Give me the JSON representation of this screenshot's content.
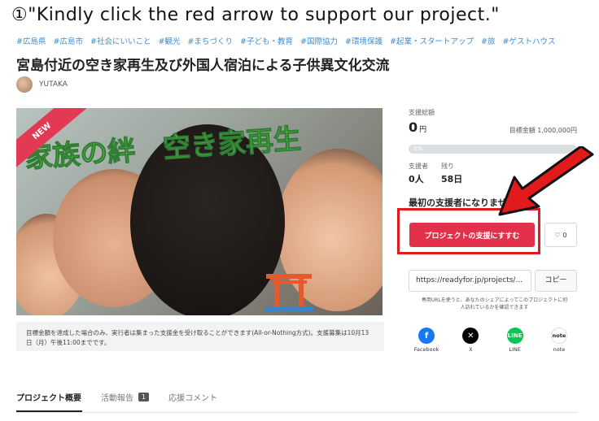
{
  "instruction": "①\"Kindly click the red arrow to support our project.\"",
  "tags": [
    "#広島県",
    "#広島市",
    "#社会にいいこと",
    "#観光",
    "#まちづくり",
    "#子ども・教育",
    "#国際協力",
    "#環境保護",
    "#起業・スタートアップ",
    "#旅",
    "#ゲストハウス"
  ],
  "project": {
    "title": "宮島付近の空き家再生及び外国人宿泊による子供異文化交流",
    "author": "YUTAKA",
    "hero_text": "家族の絆　空き家再生",
    "new_badge": "NEW"
  },
  "notice": "目標金額を達成した場合のみ、実行者は集まった支援金を受け取ることができます(All-or-Nothing方式)。支援募集は10月13日（月）午後11:00までです。",
  "funding": {
    "total_label": "支援総額",
    "amount": "0",
    "currency": "円",
    "goal": "目標金額 1,000,000円",
    "progress_text": "0%",
    "progress_fraction": 0,
    "supporters_label": "支援者",
    "supporters_value": "0人",
    "remaining_label": "残り",
    "remaining_value": "58日"
  },
  "cta": {
    "first_supporter": "最初の支援者になりませんか",
    "support_button": "プロジェクトの支援にすすむ",
    "like_count": "0"
  },
  "share": {
    "url": "https://readyfor.jp/projects/...",
    "copy_label": "コピー",
    "note": "専用URLを使うと、あなたのシェアによってこのプロジェクトに何人訪れているかを確認できます",
    "items": [
      {
        "label": "Facebook",
        "icon": "facebook-icon",
        "color": "#1877f2"
      },
      {
        "label": "X",
        "icon": "x-icon",
        "color": "#000000"
      },
      {
        "label": "LINE",
        "icon": "line-icon",
        "color": "#06c755"
      },
      {
        "label": "note",
        "icon": "note-icon",
        "color": "#ffffff"
      }
    ]
  },
  "tabs": [
    {
      "label": "プロジェクト概要"
    },
    {
      "label": "活動報告",
      "badge": "1"
    },
    {
      "label": "応援コメント"
    }
  ],
  "colors": {
    "accent": "#e4314b",
    "annotation_red": "#e11b1b",
    "tag_blue": "#3a8fd8"
  }
}
